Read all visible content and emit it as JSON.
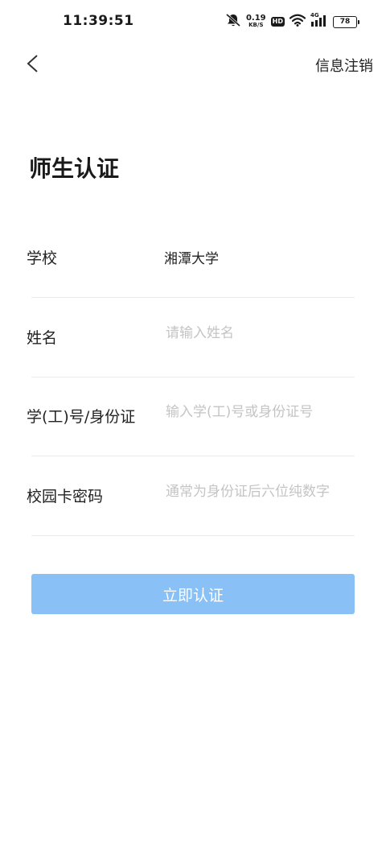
{
  "status_bar": {
    "time": "11:39:51",
    "net_speed_value": "0.19",
    "net_speed_unit": "KB/S",
    "hd_label": "HD",
    "network_type": "4G",
    "battery_level": "78"
  },
  "nav": {
    "deregister_label": "信息注销"
  },
  "title": "师生认证",
  "form": {
    "school": {
      "label": "学校",
      "value": "湘潭大学"
    },
    "name": {
      "label": "姓名",
      "placeholder": "请输入姓名"
    },
    "id_number": {
      "label": "学(工)号/身份证",
      "placeholder": "输入学(工)号或身份证号"
    },
    "card_password": {
      "label": "校园卡密码",
      "placeholder": "通常为身份证后六位纯数字"
    }
  },
  "submit_label": "立即认证",
  "colors": {
    "button_bg": "#89c0f6",
    "placeholder": "#c4c4c4",
    "divider": "#ececec"
  }
}
